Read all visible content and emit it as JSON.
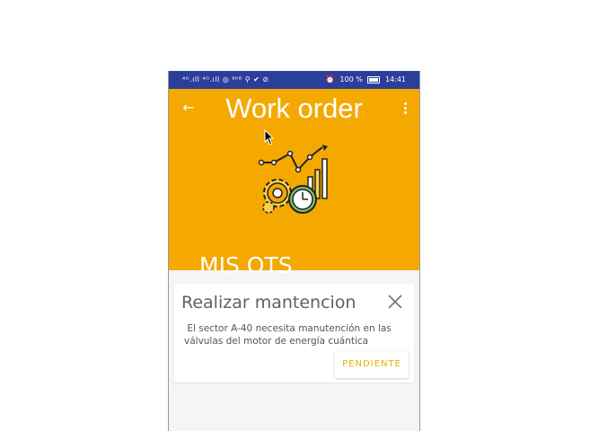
{
  "status_bar": {
    "left_text": "⁴ᴳ.ıll ⁴ᴳ.ıll ◎ ⁶ᴷᴮ ⚲ ✔ ⊘",
    "alarm": "⏰",
    "battery_text": "100 %",
    "time": "14:41"
  },
  "app_bar": {
    "back_glyph": "←",
    "title": "Work order"
  },
  "header": {
    "section_title": "MIS OTS"
  },
  "order_card": {
    "title": "Realizar mantencion",
    "description": " El sector A-40 necesita manutención en las\nválvulas del motor de energía cuántica",
    "status_label": "PENDIENTE"
  },
  "colors": {
    "status_bar": "#2b3f9a",
    "header": "#f4a800",
    "status_label": "#e8b000",
    "background": "#f5f5f5"
  },
  "icons": [
    "back-arrow-icon",
    "overflow-menu-icon",
    "gears-chart-clock-illustration",
    "close-icon",
    "mouse-cursor-icon"
  ]
}
